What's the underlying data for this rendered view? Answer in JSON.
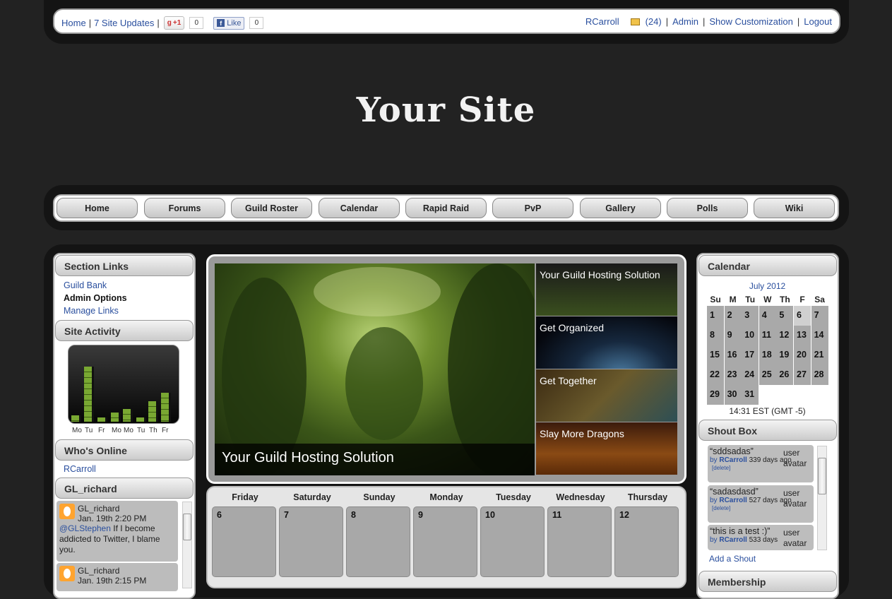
{
  "topbar": {
    "home": "Home",
    "updates": "7 Site Updates",
    "gplus": "+1",
    "gplus_count": "0",
    "fb_like": "Like",
    "fb_count": "0",
    "user": "RCarroll",
    "mail_count": "(24)",
    "admin": "Admin",
    "customization": "Show Customization",
    "logout": "Logout"
  },
  "site_title": "Your Site",
  "nav": [
    "Home",
    "Forums",
    "Guild Roster",
    "Calendar",
    "Rapid Raid",
    "PvP",
    "Gallery",
    "Polls",
    "Wiki"
  ],
  "left": {
    "section_links": {
      "title": "Section Links",
      "items": [
        "Guild Bank",
        "Admin Options",
        "Manage Links"
      ]
    },
    "site_activity": {
      "title": "Site Activity",
      "days": [
        "Mo",
        "Tu",
        "Fr",
        "Mo",
        "Mo",
        "Tu",
        "Th",
        "Fr"
      ],
      "levels": [
        0.1,
        0.85,
        0.07,
        0.14,
        0.2,
        0.07,
        0.32,
        0.45
      ]
    },
    "whos_online": {
      "title": "Who's Online",
      "users": [
        "RCarroll"
      ]
    },
    "twitter": {
      "title": "GL_richard",
      "tweets": [
        {
          "user": "GL_richard",
          "date": "Jan. 19th 2:20 PM",
          "mention": "@GLStephen",
          "text": " If I become addicted to Twitter, I blame you."
        },
        {
          "user": "GL_richard",
          "date": "Jan. 19th 2:15 PM"
        }
      ]
    }
  },
  "slider": {
    "caption": "Your Guild Hosting Solution",
    "thumbs": [
      "Your Guild Hosting Solution",
      "Get Organized",
      "Get Together",
      "Slay More Dragons"
    ]
  },
  "week": {
    "days": [
      "Friday",
      "Saturday",
      "Sunday",
      "Monday",
      "Tuesday",
      "Wednesday",
      "Thursday"
    ],
    "dates": [
      "6",
      "7",
      "8",
      "9",
      "10",
      "11",
      "12"
    ]
  },
  "right": {
    "calendar": {
      "title": "Calendar",
      "month": "July 2012",
      "dow": [
        "Su",
        "M",
        "Tu",
        "W",
        "Th",
        "F",
        "Sa"
      ],
      "days": [
        "1",
        "2",
        "3",
        "4",
        "5",
        "6",
        "7",
        "8",
        "9",
        "10",
        "11",
        "12",
        "13",
        "14",
        "15",
        "16",
        "17",
        "18",
        "19",
        "20",
        "21",
        "22",
        "23",
        "24",
        "25",
        "26",
        "27",
        "28",
        "29",
        "30",
        "31"
      ],
      "time": "14:31 EST (GMT -5)"
    },
    "shoutbox": {
      "title": "Shout Box",
      "shouts": [
        {
          "text": "“sddsadas”",
          "by": "by",
          "user": "RCarroll",
          "age": "339 days ago",
          "del": "[delete]",
          "avatar": "user avatar"
        },
        {
          "text": "“sadasdasd”",
          "by": "by",
          "user": "RCarroll",
          "age": "527 days ago",
          "del": "[delete]",
          "avatar": "user avatar"
        },
        {
          "text": "“this is a test :)”",
          "by": "by",
          "user": "RCarroll",
          "age": "533 days",
          "avatar": "user avatar"
        }
      ],
      "add": "Add a Shout"
    },
    "membership": {
      "title": "Membership"
    }
  }
}
